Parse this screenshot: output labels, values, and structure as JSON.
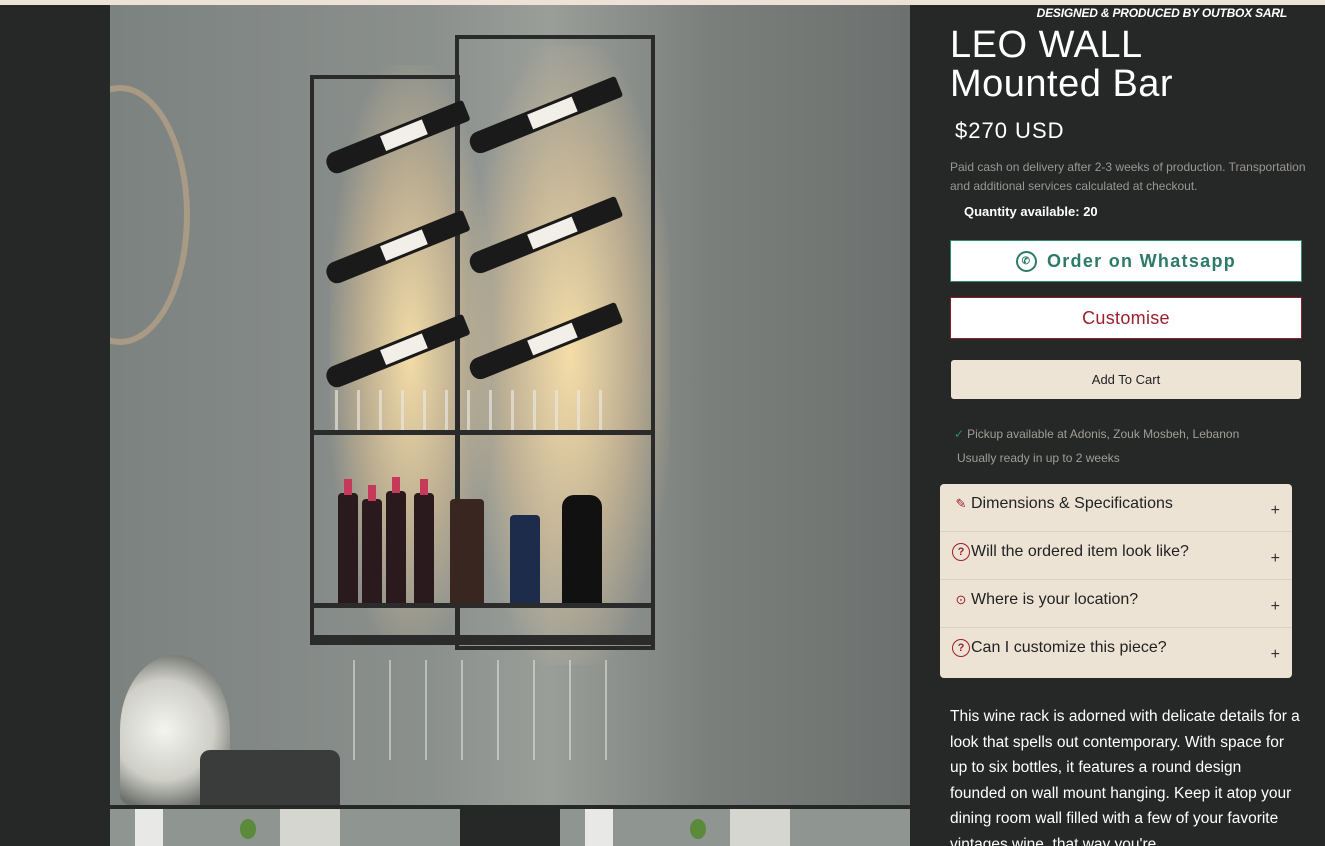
{
  "brand_line": "DESIGNED & PRODUCED BY OUTBOX SARL",
  "product": {
    "title": "LEO WALL Mounted Bar",
    "price": "$270 USD",
    "payment_note": "Paid cash on delivery after 2-3 weeks of production. Transportation and additional services calculated at checkout.",
    "quantity": "Quantity available: 20"
  },
  "buttons": {
    "whatsapp": "Order on Whatsapp",
    "customise": "Customise",
    "add_to_cart": "Add To Cart"
  },
  "pickup": {
    "location": "Pickup available at Adonis, Zouk Mosbeh, Lebanon",
    "ready": "Usually ready in up to 2 weeks"
  },
  "accordion": [
    {
      "label": "Dimensions & Specifications",
      "icon": "ruler-icon"
    },
    {
      "label": "Will the ordered item look like?",
      "icon": "question-icon"
    },
    {
      "label": "Where is your location?",
      "icon": "location-pin-icon"
    },
    {
      "label": "Can I customize this piece?",
      "icon": "question-icon"
    }
  ],
  "description": "This wine rack is adorned with delicate details for a look that spells out contemporary. With space for up to six bottles, it features a round design founded on wall mount hanging. Keep it atop your dining room wall filled with a few of your favorite vintages wine, that way you're",
  "colors": {
    "background": "#262827",
    "whatsapp_green": "#2d7a68",
    "customise_red": "#9b1f2d",
    "cart_beige": "#ede4d6"
  }
}
